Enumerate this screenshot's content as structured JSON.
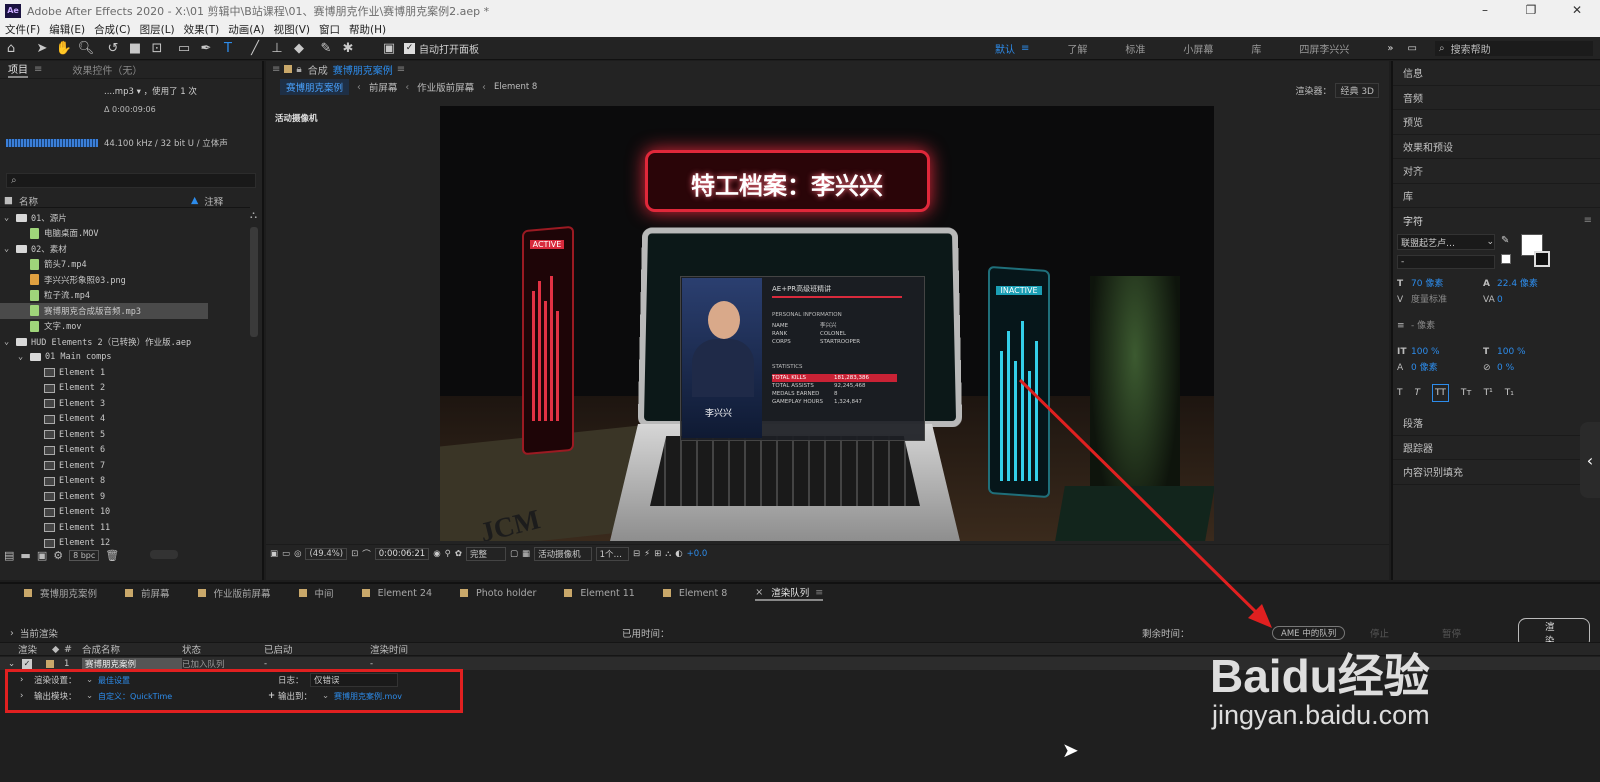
{
  "window": {
    "title": "Adobe After Effects 2020 - X:\\01 剪辑中\\B站课程\\01、赛博朋克作业\\赛博朋克案例2.aep *",
    "logo": "Ae",
    "controls": [
      "–",
      "❐",
      "✕"
    ]
  },
  "menu": [
    "文件(F)",
    "编辑(E)",
    "合成(C)",
    "图层(L)",
    "效果(T)",
    "动画(A)",
    "视图(V)",
    "窗口",
    "帮助(H)"
  ],
  "toolbar": {
    "auto_open": "自动打开面板",
    "workspaces": [
      "默认",
      "了解",
      "标准",
      "小屏幕",
      "库",
      "四屏李兴兴"
    ],
    "search": "搜索帮助"
  },
  "project": {
    "tabs": [
      "项目",
      "效果控件（无）"
    ],
    "preview": {
      "name": "....mp3",
      "used": "，使用了 1 次",
      "duration": "Δ 0:00:09:06",
      "audio": "44.100 kHz / 32 bit U / 立体声"
    },
    "header": {
      "name": "名称",
      "comment": "注释"
    },
    "items": [
      {
        "label": "01、源片",
        "type": "folder",
        "indent": 0
      },
      {
        "label": "电脑桌面.MOV",
        "type": "file",
        "indent": 1
      },
      {
        "label": "02、素材",
        "type": "folder",
        "indent": 0
      },
      {
        "label": "箭头7.mp4",
        "type": "file",
        "indent": 1
      },
      {
        "label": "李兴兴形象照03.png",
        "type": "png",
        "indent": 1
      },
      {
        "label": "粒子流.mp4",
        "type": "file",
        "indent": 1
      },
      {
        "label": "赛博朋克合成版音频.mp3",
        "type": "file",
        "indent": 1,
        "selected": true
      },
      {
        "label": "文字.mov",
        "type": "file",
        "indent": 1
      },
      {
        "label": "HUD Elements 2（已转换）作业版.aep",
        "type": "folder",
        "indent": 0
      },
      {
        "label": "01 Main comps",
        "type": "folder",
        "indent": 1
      },
      {
        "label": "Element 1",
        "type": "comp",
        "indent": 2
      },
      {
        "label": "Element 2",
        "type": "comp",
        "indent": 2
      },
      {
        "label": "Element 3",
        "type": "comp",
        "indent": 2
      },
      {
        "label": "Element 4",
        "type": "comp",
        "indent": 2
      },
      {
        "label": "Element 5",
        "type": "comp",
        "indent": 2
      },
      {
        "label": "Element 6",
        "type": "comp",
        "indent": 2
      },
      {
        "label": "Element 7",
        "type": "comp",
        "indent": 2
      },
      {
        "label": "Element 8",
        "type": "comp",
        "indent": 2
      },
      {
        "label": "Element 9",
        "type": "comp",
        "indent": 2
      },
      {
        "label": "Element 10",
        "type": "comp",
        "indent": 2
      },
      {
        "label": "Element 11",
        "type": "comp",
        "indent": 2
      },
      {
        "label": "Element 12",
        "type": "comp",
        "indent": 2
      }
    ],
    "bpc": "8 bpc"
  },
  "comp": {
    "tab_prefix": "合成",
    "tab_name": "赛博朋克案例",
    "breadcrumbs": [
      "赛博朋克案例",
      "前屏幕",
      "作业版前屏幕",
      "Element 8"
    ],
    "renderer_label": "渲染器：",
    "renderer": "经典 3D",
    "camera_label": "活动摄像机",
    "viewer": {
      "banner": "特工档案：李兴兴",
      "active": "ACTIVE",
      "inactive": "INACTIVE",
      "card_title": "AE+PR高级班精讲",
      "personal": "PERSONAL INFORMATION",
      "fields": [
        [
          "NAME",
          "李兴兴"
        ],
        [
          "RANK",
          "COLONEL"
        ],
        [
          "CORPS",
          "STARTROOPER"
        ]
      ],
      "stats_title": "STATISTICS",
      "stats": [
        [
          "TOTAL KILLS",
          "181,283,386"
        ],
        [
          "TOTAL ASSISTS",
          "92,245,468"
        ],
        [
          "MEDALS EARNED",
          "8"
        ],
        [
          "GAMEPLAY HOURS",
          "1,324,847"
        ]
      ],
      "person_name": "李兴兴",
      "sign": "JCM"
    },
    "footer": {
      "zoom": "(49.4%)",
      "time": "0:00:06:21",
      "quality": "完整",
      "camera": "活动摄像机",
      "views": "1个…",
      "exposure": "+0.0"
    }
  },
  "right": {
    "items": [
      "信息",
      "音频",
      "预览",
      "效果和预设",
      "对齐",
      "库"
    ],
    "char_title": "字符",
    "font": "联盟起艺卢…",
    "style": "-",
    "size": "70 像素",
    "leading": "22.4 像素",
    "kerning": "度量标准",
    "tracking": "0",
    "stroke": "- 像素",
    "vscale": "100 %",
    "hscale": "100 %",
    "baseline": "0 像素",
    "tsume": "0 %",
    "format_buttons": [
      "T",
      "T",
      "TT",
      "Tт",
      "T¹",
      "T₁"
    ],
    "items2": [
      "段落",
      "跟踪器",
      "内容识别填充"
    ]
  },
  "timeline": {
    "tabs": [
      "赛博朋克案例",
      "前屏幕",
      "作业版前屏幕",
      "中间",
      "Element 24",
      "Photo holder",
      "Element 11",
      "Element 8",
      "渲染队列"
    ],
    "current_render": "当前渲染",
    "elapsed": "已用时间：",
    "remaining": "剩余时间：",
    "ame_button": "AME 中的队列",
    "stop_button": "停止",
    "pause_button": "暂停",
    "render_button": "渲染",
    "columns": [
      "渲染",
      "#",
      "合成名称",
      "状态",
      "已启动",
      "渲染时间"
    ],
    "row": {
      "index": "1",
      "name": "赛博朋克案例",
      "status": "已加入队列",
      "started": "-",
      "render_time": "-"
    },
    "render_settings_label": "渲染设置：",
    "render_settings_value": "最佳设置",
    "log_label": "日志：",
    "log_value": "仅错误",
    "output_module_label": "输出模块：",
    "output_module_value": "自定义：QuickTime",
    "output_to_label": "输出到：",
    "output_to_value": "赛博朋克案例.mov"
  },
  "watermark": {
    "brand": "Baidu经验",
    "url": "jingyan.baidu.com"
  }
}
